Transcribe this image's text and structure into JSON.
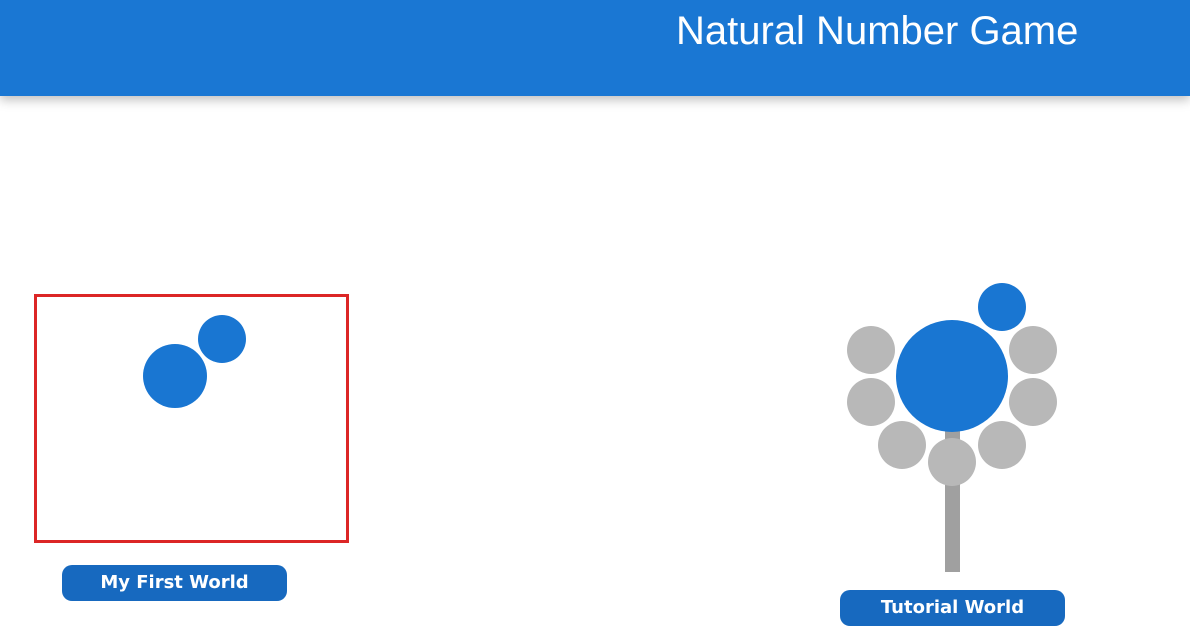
{
  "header": {
    "title": "Natural Number Game"
  },
  "worlds": [
    {
      "label": "My First World",
      "levels_total": 2,
      "levels_completed": 2,
      "selected": true
    },
    {
      "label": "Tutorial World",
      "levels_total": 8,
      "levels_completed": 0,
      "selected": false
    }
  ],
  "colors": {
    "header": "#1a77d3",
    "completed_level": "#1976d2",
    "locked_level": "#b8b8b8",
    "label_bg": "#1769bf",
    "path": "#a0a0a0",
    "highlight": "#dc2626"
  }
}
